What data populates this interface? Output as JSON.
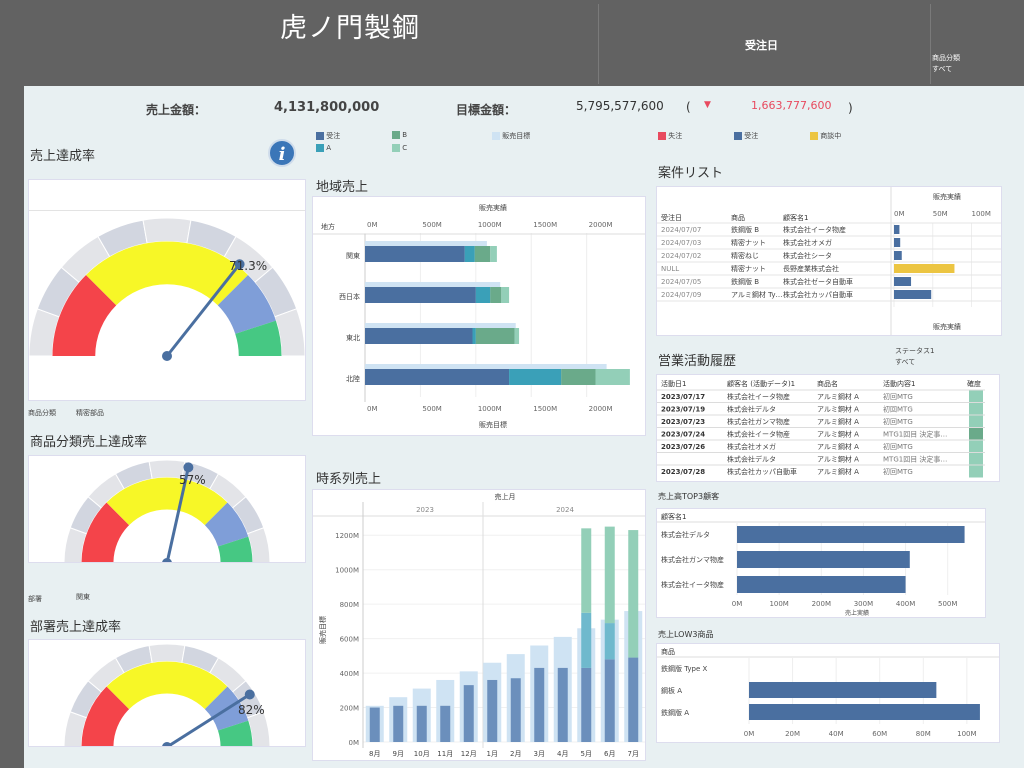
{
  "header": {
    "title": "虎ノ門製鋼",
    "date_filter_label": "受注日",
    "category_filter_label": "商品分類",
    "category_filter_value": "すべて"
  },
  "kpi": {
    "sales_label": "売上金額：",
    "sales_value": "4,131,800,000",
    "target_label": "目標金額：",
    "target_value": "5,795,577,600",
    "paren_open": "(",
    "diff_icon": "▼",
    "diff_value": "1,663,777,600",
    "paren_close": ")"
  },
  "legend1": {
    "items": [
      {
        "label": "受注",
        "color": "#4a6fa0"
      },
      {
        "label": "B",
        "color": "#6aaa8a"
      },
      {
        "label": "販売目標",
        "color": "#cfe3f3"
      },
      {
        "label": "A",
        "color": "#3aa0b8"
      },
      {
        "label": "C",
        "color": "#93cfb8"
      }
    ]
  },
  "legend2": {
    "items": [
      {
        "label": "失注",
        "color": "#e84a5f"
      },
      {
        "label": "受注",
        "color": "#4a6fa0"
      },
      {
        "label": "商談中",
        "color": "#ecc542"
      }
    ]
  },
  "gauge1": {
    "title": "売上達成率",
    "value_label": "71.3%",
    "rate": 0.713,
    "filter_label": "商品分類",
    "filter_value": "精密部品"
  },
  "gauge2": {
    "title": "商品分類売上達成率",
    "value_label": "57%",
    "rate": 0.57,
    "filter_label": "部署",
    "filter_value": "関東"
  },
  "gauge3": {
    "title": "部署売上達成率",
    "value_label": "82%",
    "rate": 0.82
  },
  "gauge_colors": {
    "red": "#f4444a",
    "yellow": "#f7f727",
    "blue": "#7f9ed8",
    "green": "#46c883",
    "light": "#e3e4e8",
    "mid": "#d2d6e0",
    "needle": "#4a6fa0"
  },
  "region": {
    "title": "地域売上",
    "top_axis_title": "販売実績",
    "bottom_axis_title": "販売目標",
    "axis_label": "地方",
    "ticks": [
      "0M",
      "500M",
      "1000M",
      "1500M",
      "2000M"
    ],
    "chart_data": {
      "type": "bar",
      "categories": [
        "関東",
        "西日本",
        "東北",
        "北陸"
      ],
      "series": [
        {
          "name": "受注",
          "values": [
            900,
            1000,
            970,
            1300
          ]
        },
        {
          "name": "A",
          "values": [
            90,
            130,
            30,
            470
          ]
        },
        {
          "name": "B",
          "values": [
            140,
            100,
            350,
            310
          ]
        },
        {
          "name": "C",
          "values": [
            60,
            70,
            40,
            310
          ]
        },
        {
          "name": "販売目標",
          "values": [
            1100,
            1220,
            1360,
            2180
          ]
        }
      ],
      "xlim": [
        0,
        2400
      ]
    }
  },
  "timeseries": {
    "title": "時系列売上",
    "top_title": "売上月",
    "year1": "2023",
    "year2": "2024",
    "ylabel": "販売目標",
    "yticks": [
      "0M",
      "200M",
      "400M",
      "600M",
      "800M",
      "1000M",
      "1200M"
    ],
    "chart_data": {
      "type": "bar",
      "categories": [
        "8月",
        "9月",
        "10月",
        "11月",
        "12月",
        "1月",
        "2月",
        "3月",
        "4月",
        "5月",
        "6月",
        "7月"
      ],
      "series": [
        {
          "name": "受注",
          "values": [
            200,
            210,
            210,
            210,
            330,
            360,
            370,
            430,
            430,
            430,
            480,
            490
          ]
        },
        {
          "name": "A",
          "values": [
            0,
            0,
            0,
            0,
            0,
            0,
            0,
            0,
            0,
            320,
            210,
            0
          ]
        },
        {
          "name": "B",
          "values": [
            0,
            0,
            0,
            0,
            0,
            0,
            0,
            0,
            0,
            490,
            560,
            740
          ]
        },
        {
          "name": "販売目標",
          "values": [
            210,
            260,
            310,
            360,
            410,
            460,
            510,
            560,
            610,
            660,
            710,
            760
          ]
        }
      ],
      "ylim": [
        0,
        1300
      ]
    }
  },
  "cases": {
    "title": "案件リスト",
    "chart_title": "販売実績",
    "chart_bottom": "販売実績",
    "columns": [
      "受注日",
      "商品",
      "顧客名1"
    ],
    "ticks": [
      "0M",
      "50M",
      "100M"
    ],
    "rows": [
      {
        "date": "2024/07/07",
        "product": "鉄鋼版 B",
        "customer": "株式会社イータ物産",
        "value": 7,
        "color": "#4a6fa0"
      },
      {
        "date": "2024/07/03",
        "product": "精密ナット",
        "customer": "株式会社オメガ",
        "value": 8,
        "color": "#4a6fa0"
      },
      {
        "date": "2024/07/02",
        "product": "精密ねじ",
        "customer": "株式会社シータ",
        "value": 10,
        "color": "#4a6fa0"
      },
      {
        "date": "NULL",
        "product": "精密ナット",
        "customer": "長野産業株式会社",
        "value": 78,
        "color": "#ecc542"
      },
      {
        "date": "2024/07/05",
        "product": "鉄鋼版 B",
        "customer": "株式会社ゼータ自動車",
        "value": 22,
        "color": "#4a6fa0"
      },
      {
        "date": "2024/07/09",
        "product": "アルミ鋼材 Ty…",
        "customer": "株式会社カッパ自動車",
        "value": 48,
        "color": "#4a6fa0"
      }
    ],
    "xlim": [
      0,
      120
    ]
  },
  "activity": {
    "title": "営業活動履歴",
    "status_label": "ステータス1",
    "status_value": "すべて",
    "columns": [
      "活動日1",
      "顧客名 (活動データ)1",
      "商品名",
      "活動内容1",
      "確度"
    ],
    "rows": [
      {
        "date": "2023/07/17",
        "customer": "株式会社イータ物産",
        "product": "アルミ鋼材 A",
        "content": "初回MTG",
        "color": "#93cfb8"
      },
      {
        "date": "2023/07/19",
        "customer": "株式会社デルタ",
        "product": "アルミ鋼材 A",
        "content": "初回MTG",
        "color": "#93cfb8"
      },
      {
        "date": "2023/07/23",
        "customer": "株式会社ガンマ物産",
        "product": "アルミ鋼材 A",
        "content": "初回MTG",
        "color": "#93cfb8"
      },
      {
        "date": "2023/07/24",
        "customer": "株式会社イータ物産",
        "product": "アルミ鋼材 A",
        "content": "MTG1回目 決定事…",
        "color": "#6aaa8a"
      },
      {
        "date": "2023/07/26",
        "customer": "株式会社オメガ",
        "product": "アルミ鋼材 A",
        "content": "初回MTG",
        "color": "#93cfb8"
      },
      {
        "date": "",
        "customer": "株式会社デルタ",
        "product": "アルミ鋼材 A",
        "content": "MTG1回目 決定事…",
        "color": "#93cfb8"
      },
      {
        "date": "2023/07/28",
        "customer": "株式会社カッパ自動車",
        "product": "アルミ鋼材 A",
        "content": "初回MTG",
        "color": "#93cfb8"
      }
    ]
  },
  "top3": {
    "title": "売上高TOP3顧客",
    "col": "顧客名1",
    "axis_title": "売上実績",
    "ticks": [
      "0M",
      "100M",
      "200M",
      "300M",
      "400M",
      "500M"
    ],
    "chart_data": {
      "type": "bar",
      "categories": [
        "株式会社デルタ",
        "株式会社ガンマ物産",
        "株式会社イータ物産"
      ],
      "values": [
        540,
        410,
        400
      ],
      "xlim": [
        0,
        560
      ]
    }
  },
  "low3": {
    "title": "売上LOW3商品",
    "col": "商品",
    "ticks": [
      "0M",
      "20M",
      "40M",
      "60M",
      "80M",
      "100M"
    ],
    "chart_data": {
      "type": "bar",
      "categories": [
        "鉄鋼版 Type X",
        "鋼板 A",
        "鉄鋼版 A"
      ],
      "values": [
        0,
        86,
        106
      ],
      "xlim": [
        0,
        112
      ]
    }
  }
}
